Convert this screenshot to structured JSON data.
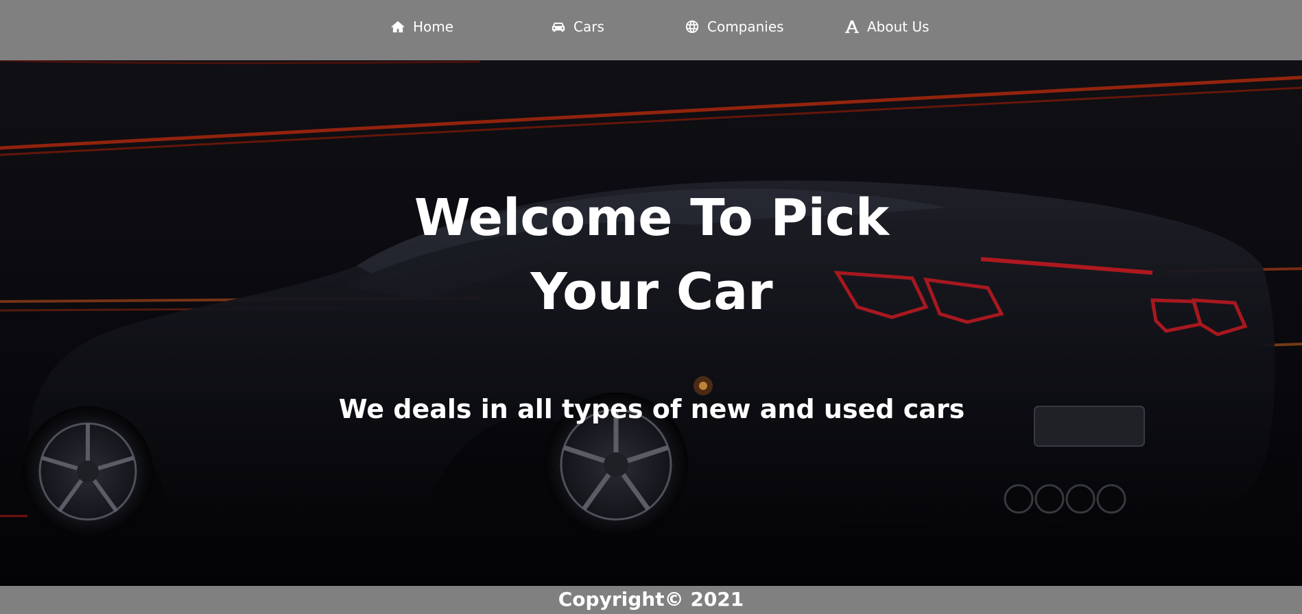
{
  "nav": {
    "items": [
      {
        "label": "Home",
        "icon": "home-icon"
      },
      {
        "label": "Cars",
        "icon": "car-icon"
      },
      {
        "label": "Companies",
        "icon": "globe-icon"
      },
      {
        "label": "About Us",
        "icon": "font-a-icon"
      }
    ]
  },
  "hero": {
    "title": "Welcome To Pick Your Car",
    "subtitle": "We deals in all types of new and used cars"
  },
  "footer": {
    "text": "Copyright© 2021"
  },
  "colors": {
    "bar_background": "#808080",
    "text": "#ffffff",
    "hero_background": "#08080d",
    "light_streak": "#ff3a10"
  }
}
